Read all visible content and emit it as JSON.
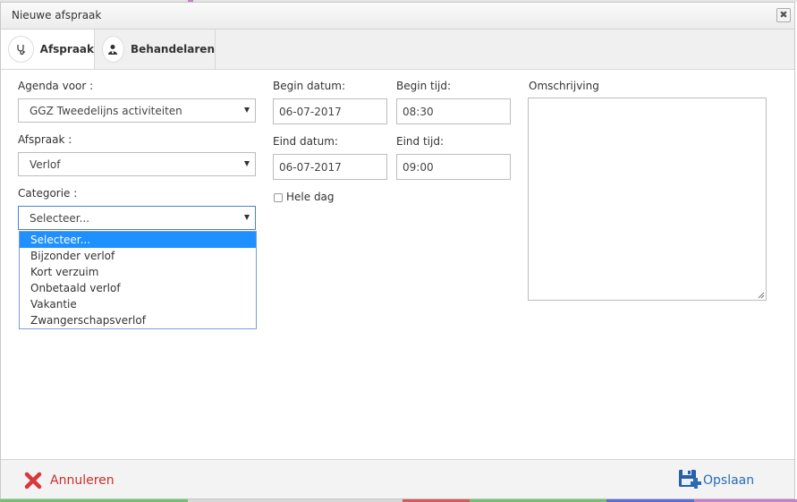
{
  "window": {
    "title": "Nieuwe afspraak"
  },
  "tabs": [
    {
      "label": "Afspraak",
      "icon": "stethoscope-icon"
    },
    {
      "label": "Behandelaren",
      "icon": "doctor-icon"
    }
  ],
  "form": {
    "agenda": {
      "label": "Agenda voor :",
      "value": "GGZ Tweedelijns activiteiten"
    },
    "afspraak": {
      "label": "Afspraak :",
      "value": "Verlof"
    },
    "categorie": {
      "label": "Categorie :",
      "value": "Selecteer...",
      "options": [
        "Selecteer...",
        "Bijzonder verlof",
        "Kort verzuim",
        "Onbetaald verlof",
        "Vakantie",
        "Zwangerschapsverlof"
      ]
    },
    "begin_datum": {
      "label": "Begin datum:",
      "value": "06-07-2017"
    },
    "begin_tijd": {
      "label": "Begin tijd:",
      "value": "08:30"
    },
    "eind_datum": {
      "label": "Eind datum:",
      "value": "06-07-2017"
    },
    "eind_tijd": {
      "label": "Eind tijd:",
      "value": "09:00"
    },
    "hele_dag": {
      "label": "Hele dag"
    },
    "omschrijving": {
      "label": "Omschrijving",
      "value": ""
    }
  },
  "footer": {
    "cancel_label": "Annuleren",
    "save_label": "Opslaan"
  },
  "colors": {
    "cancel": "#c9302c",
    "save": "#2a6db5",
    "selected_option": "#1e90ff"
  }
}
